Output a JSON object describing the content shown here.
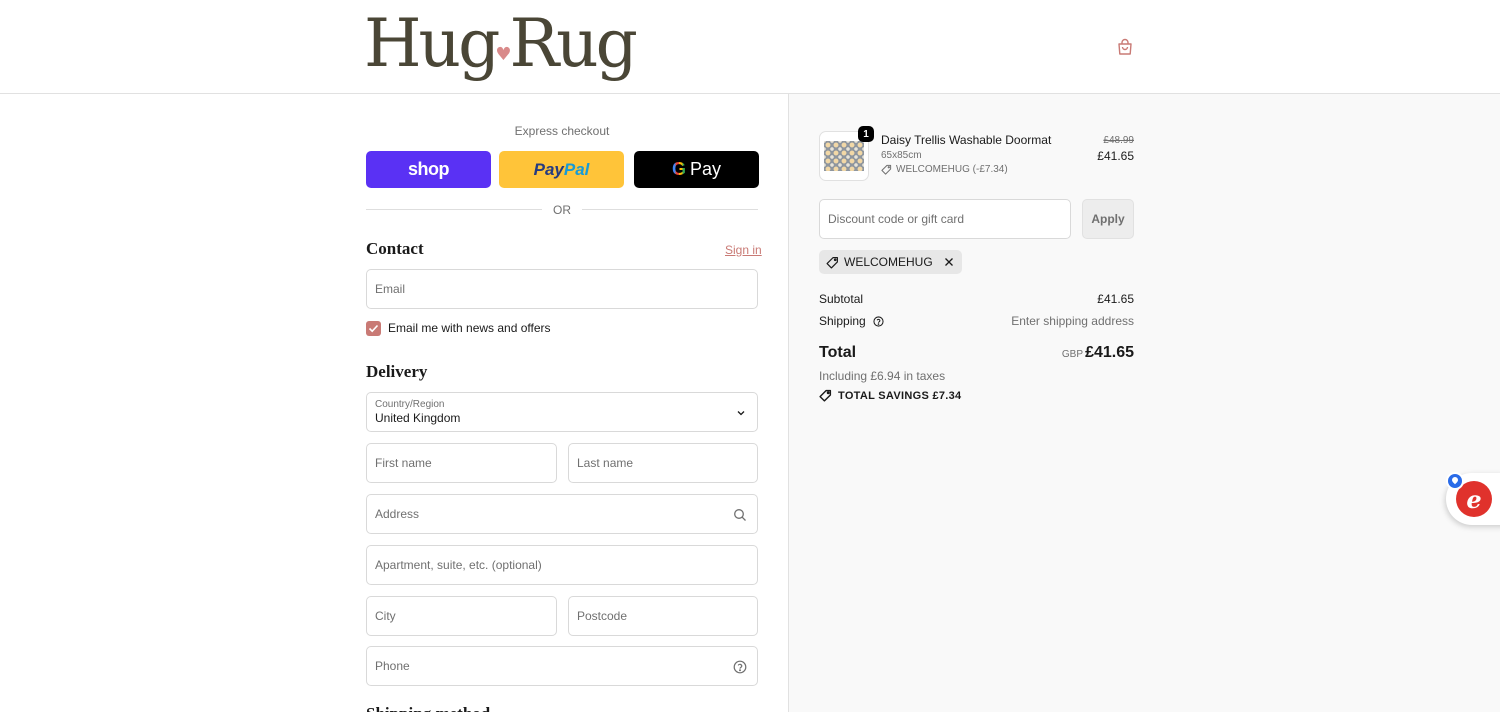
{
  "header": {
    "logo_part1": "Hug",
    "logo_heart": "♥",
    "logo_part2": "Rug",
    "cart_icon": "shopping-bag-icon"
  },
  "express": {
    "title": "Express checkout",
    "shop_label": "shop",
    "paypal_label_a": "Pay",
    "paypal_label_b": "Pal",
    "gpay_label_g": "G",
    "gpay_label": "Pay",
    "or_text": "OR"
  },
  "contact": {
    "heading": "Contact",
    "signin_label": "Sign in",
    "email_placeholder": "Email",
    "newsletter_label": "Email me with news and offers",
    "newsletter_checked": true
  },
  "delivery": {
    "heading": "Delivery",
    "country_label": "Country/Region",
    "country_value": "United Kingdom",
    "first_name_placeholder": "First name",
    "last_name_placeholder": "Last name",
    "address_placeholder": "Address",
    "apartment_placeholder": "Apartment, suite, etc. (optional)",
    "city_placeholder": "City",
    "postcode_placeholder": "Postcode",
    "phone_placeholder": "Phone",
    "next_heading": "Shipping method"
  },
  "summary": {
    "product": {
      "quantity": "1",
      "name": "Daisy Trellis Washable Doormat",
      "variant": "65x85cm",
      "discount": "WELCOMEHUG (-£7.34)",
      "price_original": "£48.99",
      "price_final": "£41.65"
    },
    "discount_placeholder": "Discount code or gift card",
    "apply_label": "Apply",
    "applied_code": "WELCOMEHUG",
    "subtotal_label": "Subtotal",
    "subtotal_value": "£41.65",
    "shipping_label": "Shipping",
    "shipping_value": "Enter shipping address",
    "total_label": "Total",
    "total_currency": "GBP",
    "total_value": "£41.65",
    "taxes_text": "Including £6.94 in taxes",
    "savings_text": "TOTAL SAVINGS £7.34"
  },
  "widget": {
    "logo_letter": "e"
  },
  "colors": {
    "accent": "#c97a75",
    "shop_pay": "#5a31f4",
    "paypal": "#ffc439",
    "gpay": "#000000",
    "logo": "#4a4636",
    "summary_bg": "#f9f9f9"
  }
}
